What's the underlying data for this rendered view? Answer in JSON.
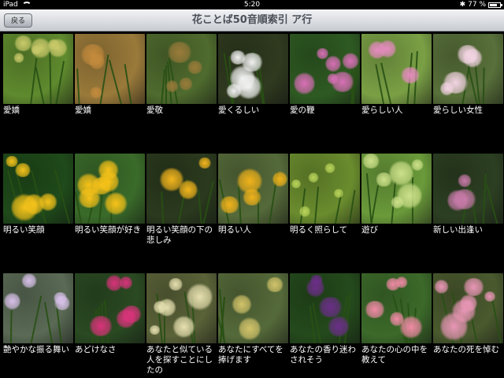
{
  "status_bar": {
    "device": "iPad",
    "time": "5:20",
    "battery_percent": "77 %",
    "battery_level": 0.77
  },
  "nav": {
    "back_label": "戻る",
    "title": "花ことば50音順索引 ア行"
  },
  "items": [
    {
      "caption": "愛嬌"
    },
    {
      "caption": "愛嬌"
    },
    {
      "caption": "愛敬"
    },
    {
      "caption": "愛くるしい"
    },
    {
      "caption": "愛の鞭"
    },
    {
      "caption": "愛らしい人"
    },
    {
      "caption": "愛らしい女性"
    },
    {
      "caption": "明るい笑顔"
    },
    {
      "caption": "明るい笑顔が好き"
    },
    {
      "caption": "明るい笑顔の下の悲しみ"
    },
    {
      "caption": "明るい人"
    },
    {
      "caption": "明るく照らして"
    },
    {
      "caption": "遊び"
    },
    {
      "caption": "新しい出逢い"
    },
    {
      "caption": "艶やかな振る舞い"
    },
    {
      "caption": "あどけなさ"
    },
    {
      "caption": "あなたと似ている人を探すことにしたの"
    },
    {
      "caption": "あなたにすべてを捧げます"
    },
    {
      "caption": "あなたの香り迷わされそう"
    },
    {
      "caption": "あなたの心の中を教えて"
    },
    {
      "caption": "あなたの死を悼む"
    }
  ],
  "colors": {
    "nav_top": "#f2f3f5",
    "nav_bottom": "#c8ccd2",
    "title": "#4a4f58",
    "photo_themes": [
      [
        "#5f8a2e",
        "#c9c96a"
      ],
      [
        "#9a7a3a",
        "#c38a3c"
      ],
      [
        "#4f6b2e",
        "#9a7b3a"
      ],
      [
        "#2f3a1f",
        "#f1f1f1"
      ],
      [
        "#2e5a22",
        "#d86fb6"
      ],
      [
        "#7aa045",
        "#e78bc0"
      ],
      [
        "#58703a",
        "#f3d4e3"
      ],
      [
        "#1f4a1a",
        "#f4c21a"
      ],
      [
        "#3a6b2a",
        "#f7c218"
      ],
      [
        "#2b3a1e",
        "#f2b51c"
      ],
      [
        "#556a3a",
        "#f0b21a"
      ],
      [
        "#6a8c2e",
        "#b9d45a"
      ],
      [
        "#6a9a3a",
        "#cde08a"
      ],
      [
        "#2c3f22",
        "#c77aa8"
      ],
      [
        "#5a6a55",
        "#d7c0e8"
      ],
      [
        "#2a4a22",
        "#d8337a"
      ],
      [
        "#5a6238",
        "#e6dfb0"
      ],
      [
        "#556a3a",
        "#d2c36a"
      ],
      [
        "#244a1c",
        "#6b2e88"
      ],
      [
        "#3c6a2a",
        "#f08aa5"
      ],
      [
        "#4a5a2e",
        "#e996b6"
      ]
    ]
  }
}
